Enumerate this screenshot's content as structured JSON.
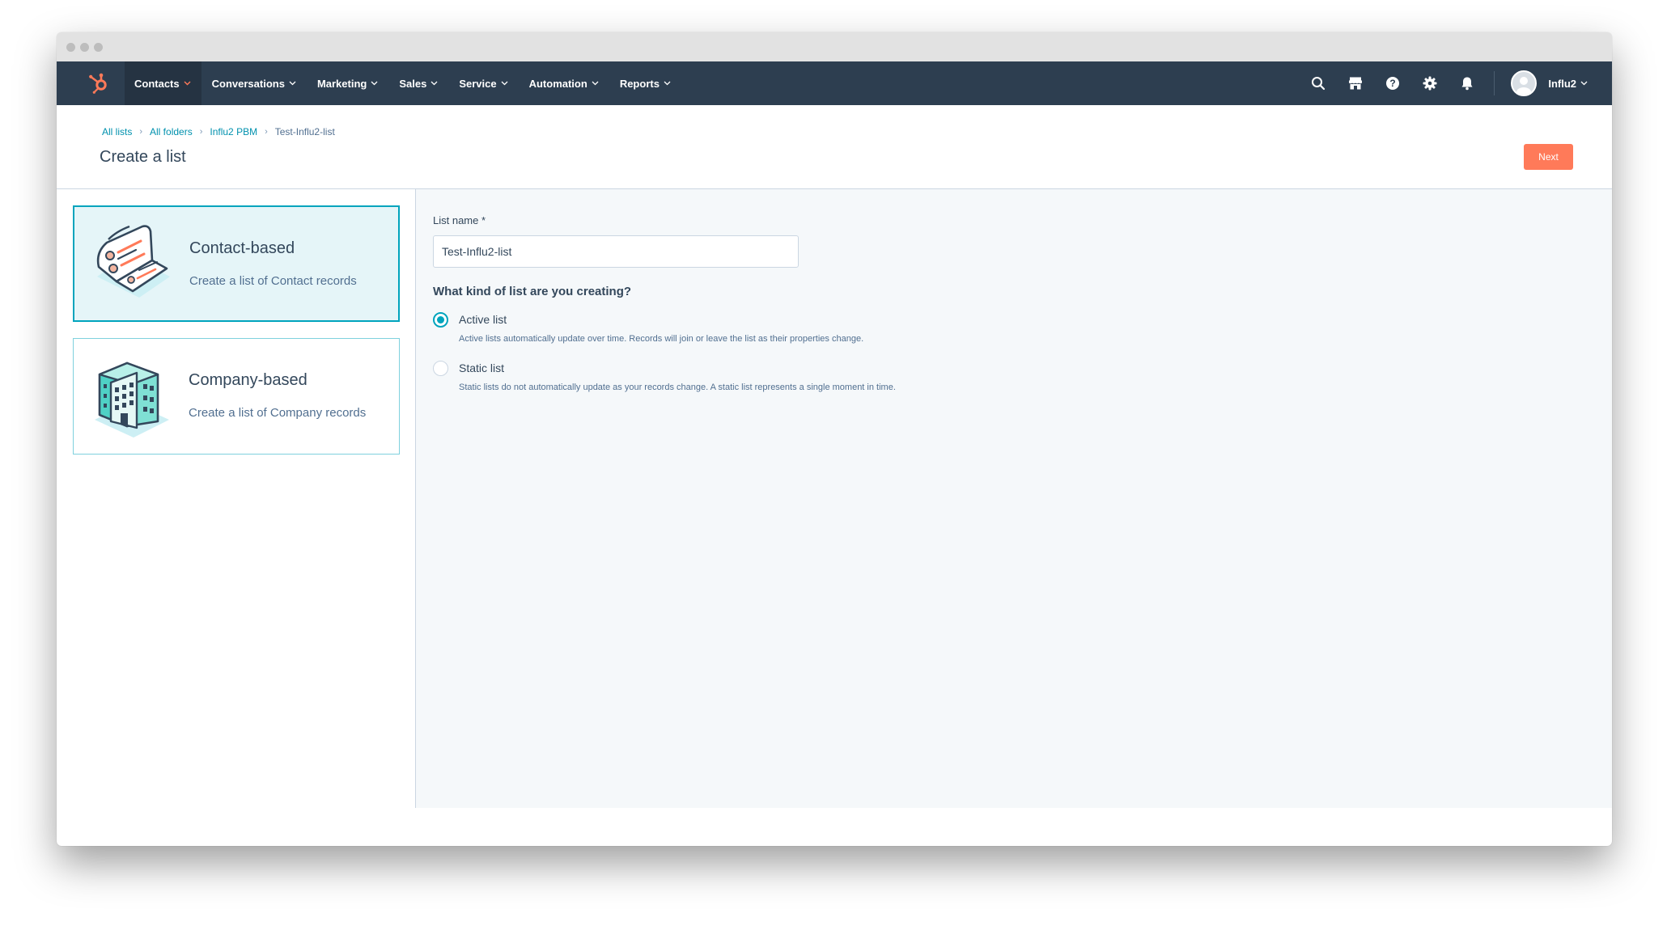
{
  "nav": {
    "menu": [
      {
        "label": "Contacts",
        "active": true
      },
      {
        "label": "Conversations",
        "active": false
      },
      {
        "label": "Marketing",
        "active": false
      },
      {
        "label": "Sales",
        "active": false
      },
      {
        "label": "Service",
        "active": false
      },
      {
        "label": "Automation",
        "active": false
      },
      {
        "label": "Reports",
        "active": false
      }
    ],
    "icons": [
      "search-icon",
      "marketplace-icon",
      "help-icon",
      "settings-icon",
      "notifications-icon"
    ],
    "user_name": "Influ2"
  },
  "breadcrumb": {
    "links": [
      "All lists",
      "All folders",
      "Influ2 PBM"
    ],
    "current": "Test-Influ2-list"
  },
  "page": {
    "title": "Create a list",
    "next_label": "Next"
  },
  "list_types": [
    {
      "title": "Contact-based",
      "desc": "Create a list of Contact records",
      "selected": true
    },
    {
      "title": "Company-based",
      "desc": "Create a list of Company records",
      "selected": false
    }
  ],
  "form": {
    "name_label": "List name *",
    "name_value": "Test-Influ2-list",
    "question": "What kind of list are you creating?",
    "options": [
      {
        "label": "Active list",
        "help": "Active lists automatically update over time. Records will join or leave the list as their properties change.",
        "checked": true
      },
      {
        "label": "Static list",
        "help": "Static lists do not automatically update as your records change. A static list represents a single moment in time.",
        "checked": false
      }
    ]
  },
  "colors": {
    "nav_bg": "#2d3e50",
    "accent": "#00a4bd",
    "primary_button": "#ff7a59",
    "link": "#0091ae"
  }
}
